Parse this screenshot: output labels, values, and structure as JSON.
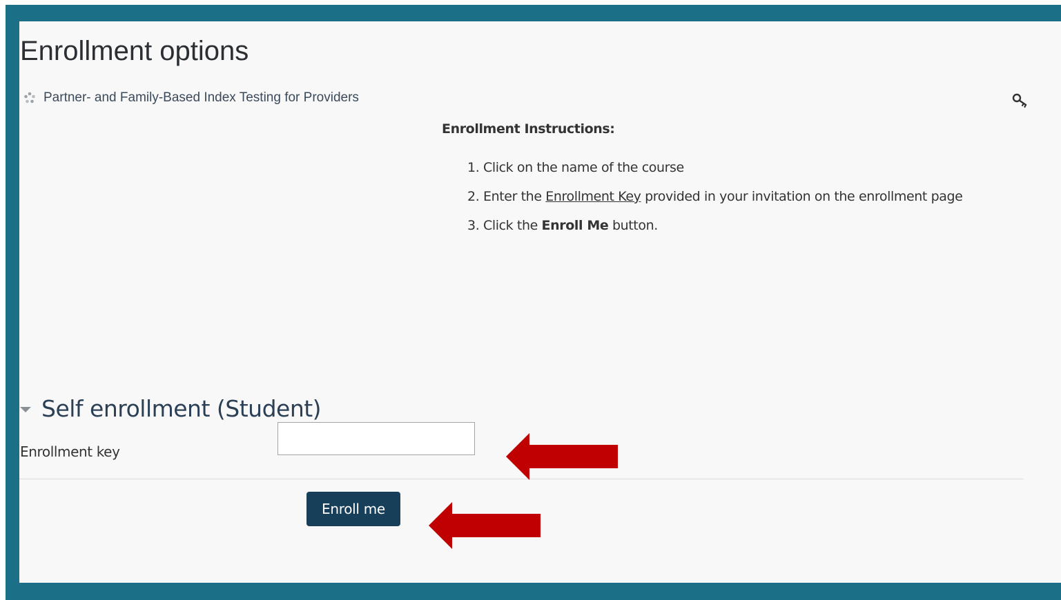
{
  "page": {
    "title": "Enrollment options"
  },
  "course": {
    "name": "Partner- and Family-Based Index Testing for Providers"
  },
  "instructions": {
    "heading": "Enrollment Instructions:",
    "step1": "Click on the name of the course",
    "step2_pre": "Enter the ",
    "step2_link": "Enrollment Key",
    "step2_post": " provided in your invitation on the enrollment page",
    "step3_pre": "Click the ",
    "step3_bold": "Enroll Me",
    "step3_post": " button."
  },
  "self_enrollment": {
    "title": "Self enrollment (Student)",
    "key_label": "Enrollment key",
    "key_value": "",
    "button_label": "Enroll me"
  },
  "colors": {
    "frame": "#1b6f87",
    "button": "#173f5a",
    "arrow": "#c00000"
  }
}
